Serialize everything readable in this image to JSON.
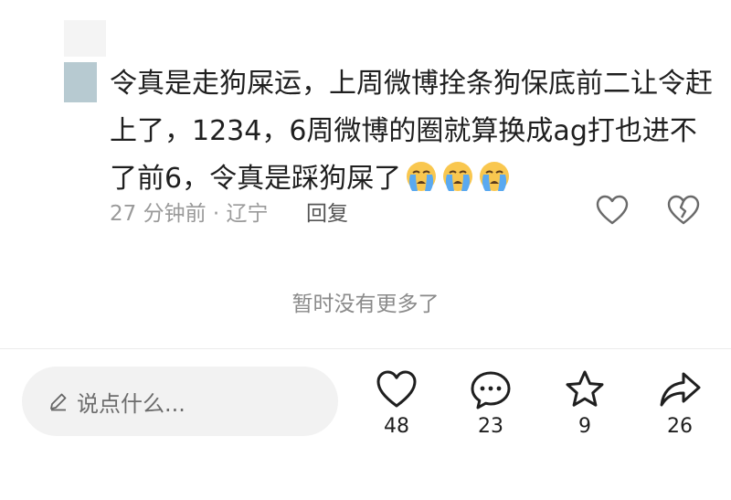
{
  "comment": {
    "text": "令真是走狗屎运，上周微博拴条狗保底前二让令赶上了，1234，6周微博的圈就算换成ag打也进不了前6，令真是踩狗屎了",
    "emojis": [
      "crying-face-emoji",
      "crying-face-emoji",
      "crying-face-emoji"
    ],
    "meta": "27 分钟前 · 辽宁",
    "reply_label": "回复",
    "like_icon": "heart-outline-icon",
    "dislike_icon": "broken-heart-icon"
  },
  "footer_note": "暂时没有更多了",
  "bottom_bar": {
    "input_placeholder": "说点什么...",
    "input_icon": "pencil-icon",
    "likes": "48",
    "comments": "23",
    "favorites": "9",
    "shares": "26"
  },
  "colors": {
    "avatar": "#b7cad1",
    "meta_text": "#9a9a9a",
    "input_bg": "#f2f2f2",
    "emoji_face": "#f9c74f",
    "emoji_tears": "#5aa9f0"
  }
}
